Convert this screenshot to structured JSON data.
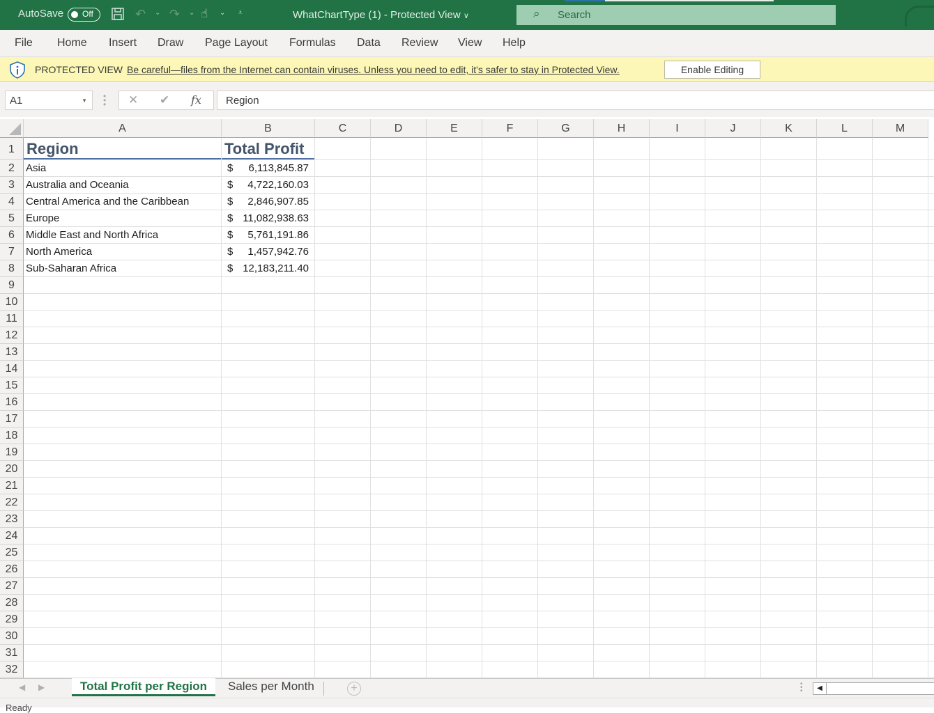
{
  "titlebar": {
    "autosave_label": "AutoSave",
    "autosave_state": "Off",
    "document_title": "WhatChartType (1)  -  Protected View",
    "search_placeholder": "Search"
  },
  "menu": {
    "items": [
      "File",
      "Home",
      "Insert",
      "Draw",
      "Page Layout",
      "Formulas",
      "Data",
      "Review",
      "View",
      "Help"
    ]
  },
  "protected_view": {
    "label": "PROTECTED VIEW",
    "message": "Be careful—files from the Internet can contain viruses. Unless you need to edit, it's safer to stay in Protected View.",
    "enable_button": "Enable Editing"
  },
  "formula_bar": {
    "name_box": "A1",
    "cancel_icon": "✕",
    "enter_icon": "✔",
    "fx_label": "fx",
    "content": "Region"
  },
  "sheet": {
    "columns": [
      "A",
      "B",
      "C",
      "D",
      "E",
      "F",
      "G",
      "H",
      "I",
      "J",
      "K",
      "L",
      "M"
    ],
    "row_numbers": [
      "1",
      "2",
      "3",
      "4",
      "5",
      "6",
      "7",
      "8",
      "9",
      "10",
      "11",
      "12",
      "13",
      "14",
      "15",
      "16",
      "17",
      "18",
      "19",
      "20",
      "21",
      "22",
      "23",
      "24",
      "25",
      "26",
      "27",
      "28",
      "29",
      "30",
      "31",
      "32"
    ],
    "header": {
      "region": "Region",
      "total_profit": "Total Profit"
    },
    "currency_symbol": "$",
    "rows": [
      {
        "region": "Asia",
        "profit": "6,113,845.87"
      },
      {
        "region": "Australia and Oceania",
        "profit": "4,722,160.03"
      },
      {
        "region": "Central America and the Caribbean",
        "profit": "2,846,907.85"
      },
      {
        "region": "Europe",
        "profit": "11,082,938.63"
      },
      {
        "region": "Middle East and North Africa",
        "profit": "5,761,191.86"
      },
      {
        "region": "North America",
        "profit": "1,457,942.76"
      },
      {
        "region": "Sub-Saharan Africa",
        "profit": "12,183,211.40"
      }
    ]
  },
  "sheet_tabs": {
    "active": "Total Profit per Region",
    "inactive": "Sales per Month",
    "add_icon": "+"
  },
  "status": {
    "text": "Ready"
  },
  "colors": {
    "excel_green": "#217346",
    "protected_bar": "#fcf7b6",
    "header_text": "#44546a",
    "header_underline": "#4f6fa0"
  }
}
